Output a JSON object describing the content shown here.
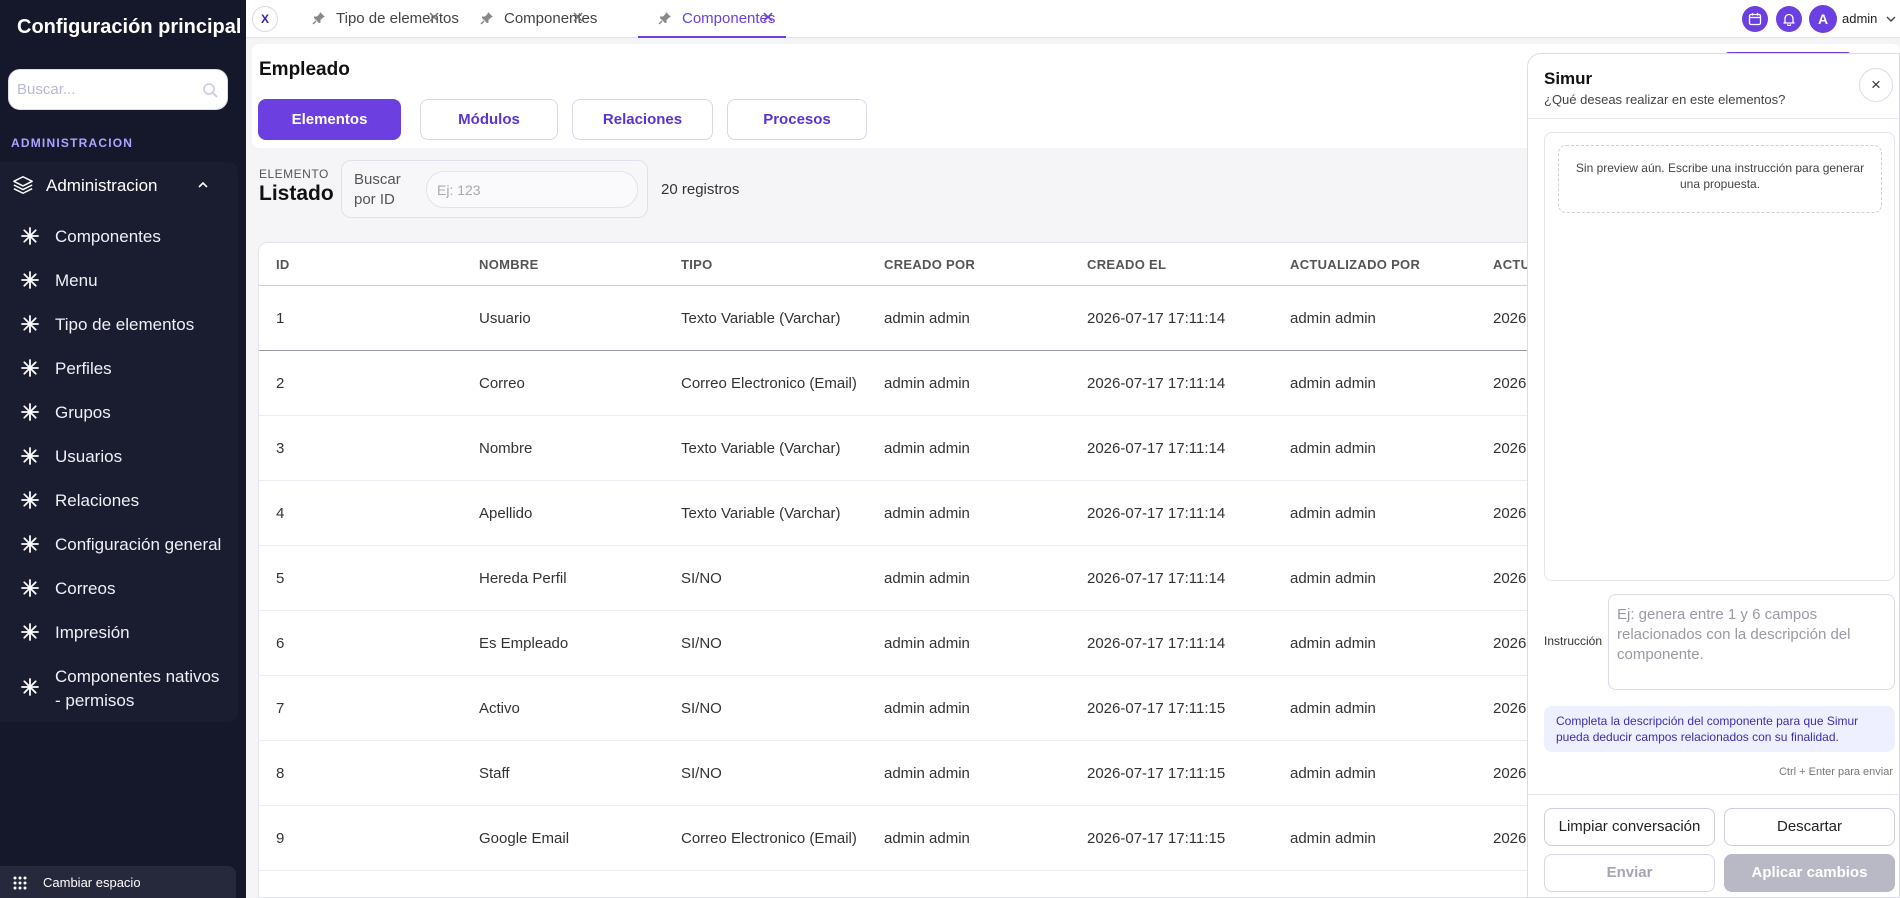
{
  "sidebar": {
    "title": "Configuración principal",
    "search_placeholder": "Buscar...",
    "section_label": "ADMINISTRACION",
    "group_label": "Administracion",
    "items": [
      {
        "label": "Componentes"
      },
      {
        "label": "Menu"
      },
      {
        "label": "Tipo de elementos"
      },
      {
        "label": "Perfiles"
      },
      {
        "label": "Grupos"
      },
      {
        "label": "Usuarios"
      },
      {
        "label": "Relaciones"
      },
      {
        "label": "Configuración general"
      },
      {
        "label": "Correos"
      },
      {
        "label": "Impresión"
      },
      {
        "label": "Componentes nativos - permisos"
      }
    ],
    "bottom_label": "Cambiar espacio"
  },
  "topbar": {
    "close_all": "X",
    "tabs": [
      {
        "label": "Tipo de elementos",
        "active": false
      },
      {
        "label": "Componentes",
        "active": false
      },
      {
        "label": "Componentes",
        "active": true
      }
    ],
    "user_initial": "A",
    "user_name": "admin"
  },
  "main": {
    "title": "Empleado",
    "pills": [
      "Elementos",
      "Módulos",
      "Relaciones",
      "Procesos"
    ],
    "element_small": "ELEMENTO",
    "element_big": "Listado",
    "search_label": "Buscar por ID",
    "search_placeholder": "Ej: 123",
    "count": "20 registros"
  },
  "table": {
    "headers": [
      "ID",
      "NOMBRE",
      "TIPO",
      "CREADO POR",
      "CREADO EL",
      "ACTUALIZADO POR",
      "ACTU"
    ],
    "rows": [
      [
        "1",
        "Usuario",
        "Texto Variable (Varchar)",
        "admin admin",
        "2026-07-17 17:11:14",
        "admin admin",
        "2026-"
      ],
      [
        "2",
        "Correo",
        "Correo Electronico (Email)",
        "admin admin",
        "2026-07-17 17:11:14",
        "admin admin",
        "2026-"
      ],
      [
        "3",
        "Nombre",
        "Texto Variable (Varchar)",
        "admin admin",
        "2026-07-17 17:11:14",
        "admin admin",
        "2026-"
      ],
      [
        "4",
        "Apellido",
        "Texto Variable (Varchar)",
        "admin admin",
        "2026-07-17 17:11:14",
        "admin admin",
        "2026-"
      ],
      [
        "5",
        "Hereda Perfil",
        "SI/NO",
        "admin admin",
        "2026-07-17 17:11:14",
        "admin admin",
        "2026-"
      ],
      [
        "6",
        "Es Empleado",
        "SI/NO",
        "admin admin",
        "2026-07-17 17:11:14",
        "admin admin",
        "2026-"
      ],
      [
        "7",
        "Activo",
        "SI/NO",
        "admin admin",
        "2026-07-17 17:11:15",
        "admin admin",
        "2026-"
      ],
      [
        "8",
        "Staff",
        "SI/NO",
        "admin admin",
        "2026-07-17 17:11:15",
        "admin admin",
        "2026-"
      ],
      [
        "9",
        "Google Email",
        "Correo Electronico (Email)",
        "admin admin",
        "2026-07-17 17:11:15",
        "admin admin",
        "2026-"
      ]
    ]
  },
  "panel": {
    "title": "Simur",
    "subtitle": "¿Qué deseas realizar en este elementos?",
    "close": "×",
    "preview_text": "Sin preview aún. Escribe una instrucción para generar una propuesta.",
    "instruction_label": "Instrucción",
    "instruction_placeholder": "Ej: genera entre 1 y 6 campos relacionados con la descripción del componente.",
    "hint": "Completa la descripción del componente para que Simur pueda deducir campos relacionados con su finalidad.",
    "shortcut": "Ctrl + Enter para enviar",
    "btn_clear": "Limpiar conversación",
    "btn_discard": "Descartar",
    "btn_send": "Enviar",
    "btn_apply": "Aplicar cambios"
  },
  "colors": {
    "accent": "#6b3fe0",
    "sidebar_bg": "#15172b",
    "section_label": "#a9a6ff"
  },
  "icons": [
    "search-icon",
    "layers-icon",
    "chevron-up-icon",
    "asterisk-icon",
    "grid-icon",
    "pin-icon",
    "close-icon",
    "calendar-icon",
    "bell-icon",
    "chevron-down-icon"
  ]
}
